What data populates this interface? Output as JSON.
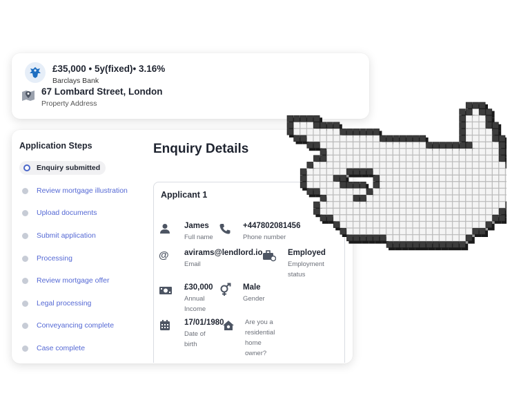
{
  "summary": {
    "loan": "£35,000 • 5y(fixed)• 3.16%",
    "bank": "Barclays Bank",
    "address": "67 Lombard Street, London",
    "address_label": "Property Address"
  },
  "steps": {
    "title": "Application Steps",
    "items": [
      {
        "label": "Enquiry submitted",
        "active": true
      },
      {
        "label": "Review mortgage illustration"
      },
      {
        "label": "Upload documents"
      },
      {
        "label": "Submit application"
      },
      {
        "label": "Processing"
      },
      {
        "label": "Review mortgage offer"
      },
      {
        "label": "Legal processing"
      },
      {
        "label": "Conveyancing complete"
      },
      {
        "label": "Case complete"
      }
    ]
  },
  "enquiry": {
    "title": "Enquiry Details",
    "applicant_title": "Applicant 1",
    "name": {
      "value": "James",
      "label": "Full name"
    },
    "phone": {
      "value": "+447802081456",
      "label": "Phone number"
    },
    "email": {
      "value": "avirams@lendlord.io",
      "label": "Email"
    },
    "employment": {
      "value": "Employed",
      "label_1": "Employment",
      "label_2": "status"
    },
    "income": {
      "value": "£30,000",
      "label_1": "Annual",
      "label_2": "Income"
    },
    "gender": {
      "value": "Male",
      "label": "Gender"
    },
    "dob": {
      "value": "17/01/1980",
      "label_1": "Date of",
      "label_2": "birth"
    },
    "residential": {
      "q1": "Are you a",
      "q2": "residential",
      "q3": "home",
      "q4": "owner?"
    }
  },
  "colors": {
    "accent": "#5468d4",
    "active_ring": "#4a66c9",
    "bank_blue": "#1f6fc1"
  },
  "icons": [
    "barclays-eagle-icon",
    "map-pin-icon",
    "user-icon",
    "phone-icon",
    "at-icon",
    "briefcase-icon",
    "banknote-icon",
    "gender-icon",
    "calendar-icon",
    "home-icon",
    "pixel-hand-cursor-icon"
  ]
}
